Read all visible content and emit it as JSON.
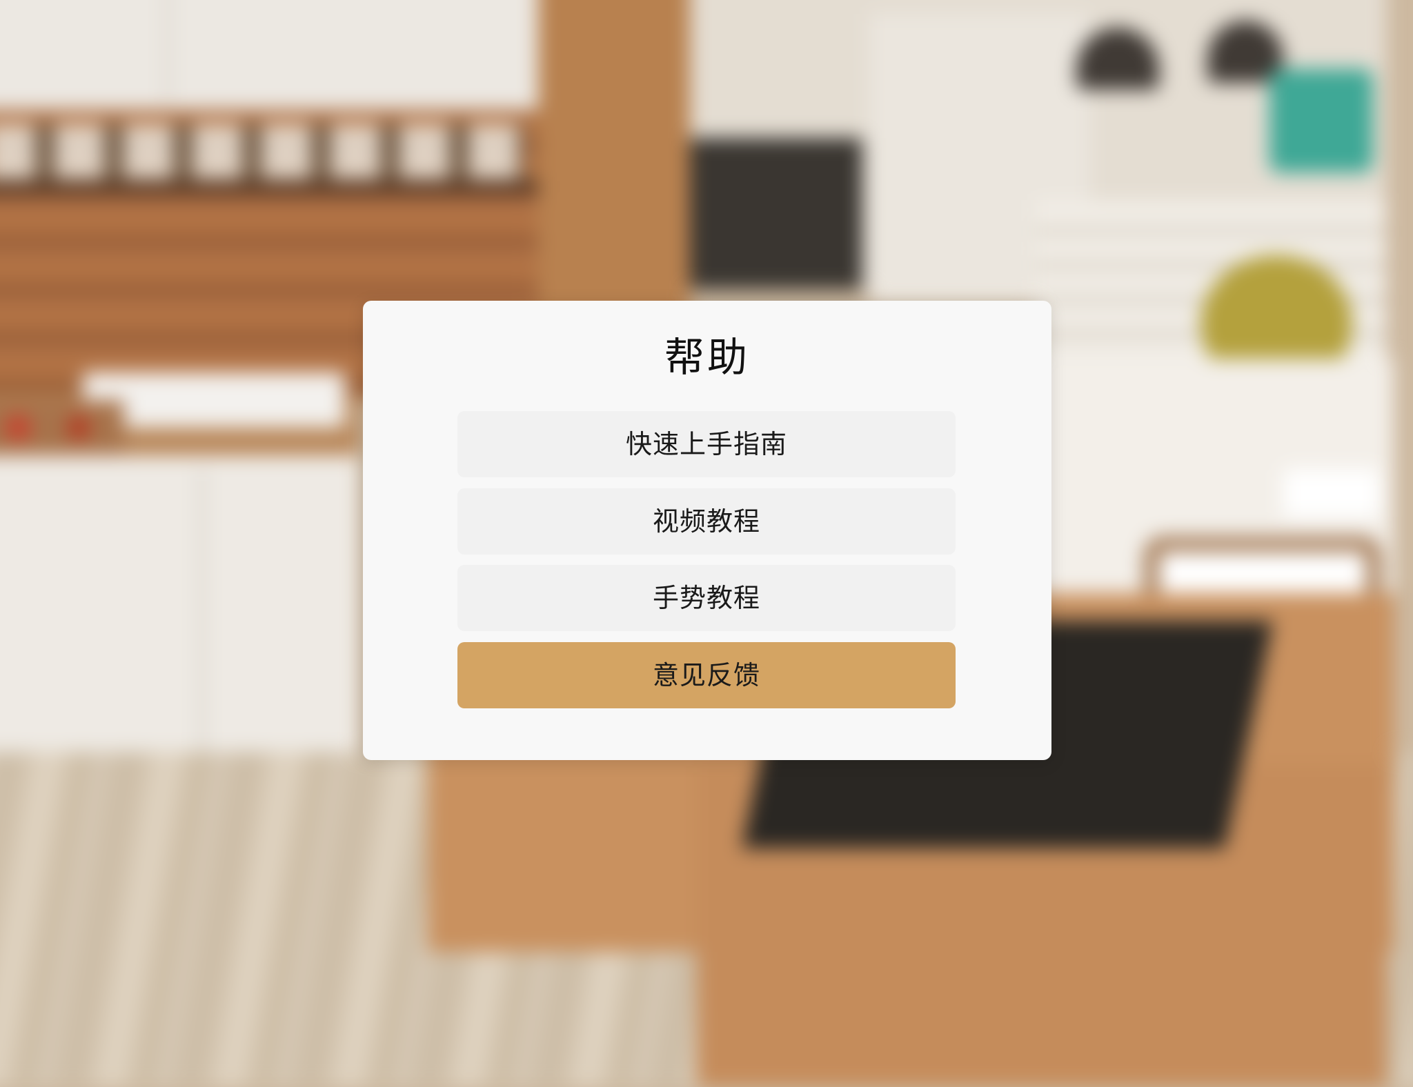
{
  "dialog": {
    "title": "帮助",
    "items": [
      {
        "label": "快速上手指南",
        "highlighted": false
      },
      {
        "label": "视频教程",
        "highlighted": false
      },
      {
        "label": "手势教程",
        "highlighted": false
      },
      {
        "label": "意见反馈",
        "highlighted": true
      }
    ]
  },
  "colors": {
    "dialog_background": "#f8f8f8",
    "button_background": "#f1f1f1",
    "highlight_accent": "#d4a463",
    "text": "#111111"
  }
}
